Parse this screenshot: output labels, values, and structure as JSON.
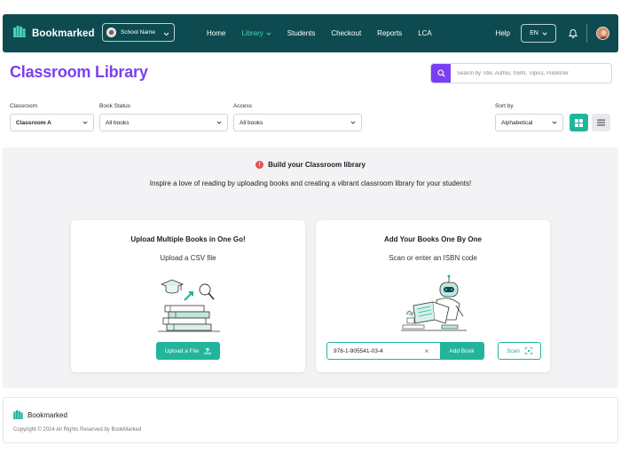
{
  "brand": {
    "name": "Bookmarked"
  },
  "navbar": {
    "school_select": "School Name",
    "links": [
      {
        "label": "Home"
      },
      {
        "label": "Library",
        "active": true
      },
      {
        "label": "Students"
      },
      {
        "label": "Checkout"
      },
      {
        "label": "Reports"
      },
      {
        "label": "LCA"
      }
    ],
    "help": "Help",
    "language": "EN"
  },
  "header": {
    "title": "Classroom Library",
    "search_placeholder": "Search by Title, Author, ISBN, Topics, Publisher"
  },
  "filters": {
    "classroom": {
      "label": "Classroom",
      "value": "Classroom A"
    },
    "book_status": {
      "label": "Book Status",
      "value": "All books"
    },
    "access": {
      "label": "Access",
      "value": "All books"
    },
    "sort_by": {
      "label": "Sort by",
      "value": "Alphabetical"
    }
  },
  "main": {
    "notice_icon": "!",
    "notice_title": "Build your Classroom library",
    "notice_text": "Inspire a love of reading by uploading books and creating a vibrant classroom library for your students!",
    "upload_card": {
      "title": "Upload Multiple Books in One Go!",
      "subtitle": "Upload a CSV file",
      "button": "Upload a File"
    },
    "isbn_card": {
      "title": "Add Your Books One By One",
      "subtitle": "Scan or enter an ISBN code",
      "isbn_value": "978-1-905541-03-4",
      "clear": "×",
      "add_button": "Add Book",
      "scan_button": "Scan"
    }
  },
  "footer": {
    "brand": "Bookmarked",
    "copyright": "Copyright © 2024 All Rights Reserved by BookMarked"
  },
  "colors": {
    "navbar": "#0e4b50",
    "accent_teal": "#22b59b",
    "title_purple": "#7a3ff2",
    "nav_active": "#45d0b3"
  },
  "icons": [
    "book-logo-icon",
    "chevron-down-icon",
    "bell-icon",
    "search-icon",
    "grid-view-icon",
    "list-view-icon",
    "upload-icon",
    "scan-icon",
    "alert-icon"
  ]
}
